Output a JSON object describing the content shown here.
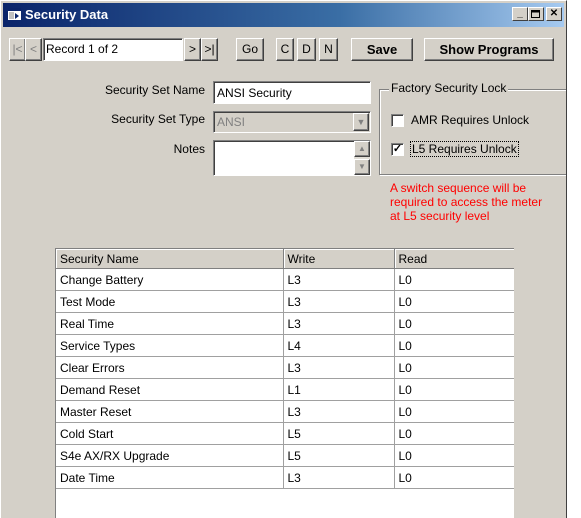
{
  "window": {
    "title": "Security Data"
  },
  "nav": {
    "first": "|<",
    "prev": "<",
    "record": "Record 1 of 2",
    "next": ">",
    "last": ">|",
    "go": "Go",
    "c": "C",
    "d": "D",
    "n": "N",
    "save": "Save",
    "show_programs": "Show Programs"
  },
  "form": {
    "set_name_label": "Security Set Name",
    "set_name_value": "ANSI Security",
    "set_type_label": "Security Set Type",
    "set_type_value": "ANSI",
    "notes_label": "Notes",
    "notes_value": ""
  },
  "factory_lock": {
    "title": "Factory Security Lock",
    "amr": {
      "label": "AMR Requires Unlock",
      "checked": false
    },
    "l5": {
      "label": "L5 Requires Unlock",
      "checked": true
    }
  },
  "warning": "A switch sequence will be required to access the meter at L5 security level",
  "table": {
    "headers": [
      "Security Name",
      "Write",
      "Read"
    ],
    "rows": [
      [
        "Change Battery",
        "L3",
        "L0"
      ],
      [
        "Test Mode",
        "L3",
        "L0"
      ],
      [
        "Real Time",
        "L3",
        "L0"
      ],
      [
        "Service Types",
        "L4",
        "L0"
      ],
      [
        "Clear Errors",
        "L3",
        "L0"
      ],
      [
        "Demand Reset",
        "L1",
        "L0"
      ],
      [
        "Master Reset",
        "L3",
        "L0"
      ],
      [
        "Cold Start",
        "L5",
        "L0"
      ],
      [
        "S4e AX/RX Upgrade",
        "L5",
        "L0"
      ],
      [
        "Date Time",
        "L3",
        "L0"
      ]
    ]
  }
}
